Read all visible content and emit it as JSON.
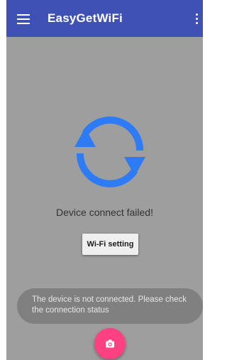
{
  "app_bar": {
    "title": "EasyGetWiFi",
    "menu_icon": "hamburger-menu-icon",
    "overflow_icon": "more-vert-icon",
    "color": "#3f51b5"
  },
  "main": {
    "status_icon": "sync-icon",
    "status_icon_color": "#2d7cf6",
    "status_text": "Device connect failed!",
    "wifi_button_label": "Wi-Fi setting",
    "background_color": "#9e9e9e"
  },
  "toast": {
    "message": "The device is not connected. Please check the connection status"
  },
  "fab": {
    "icon": "camera-icon",
    "color": "#ff4081"
  }
}
